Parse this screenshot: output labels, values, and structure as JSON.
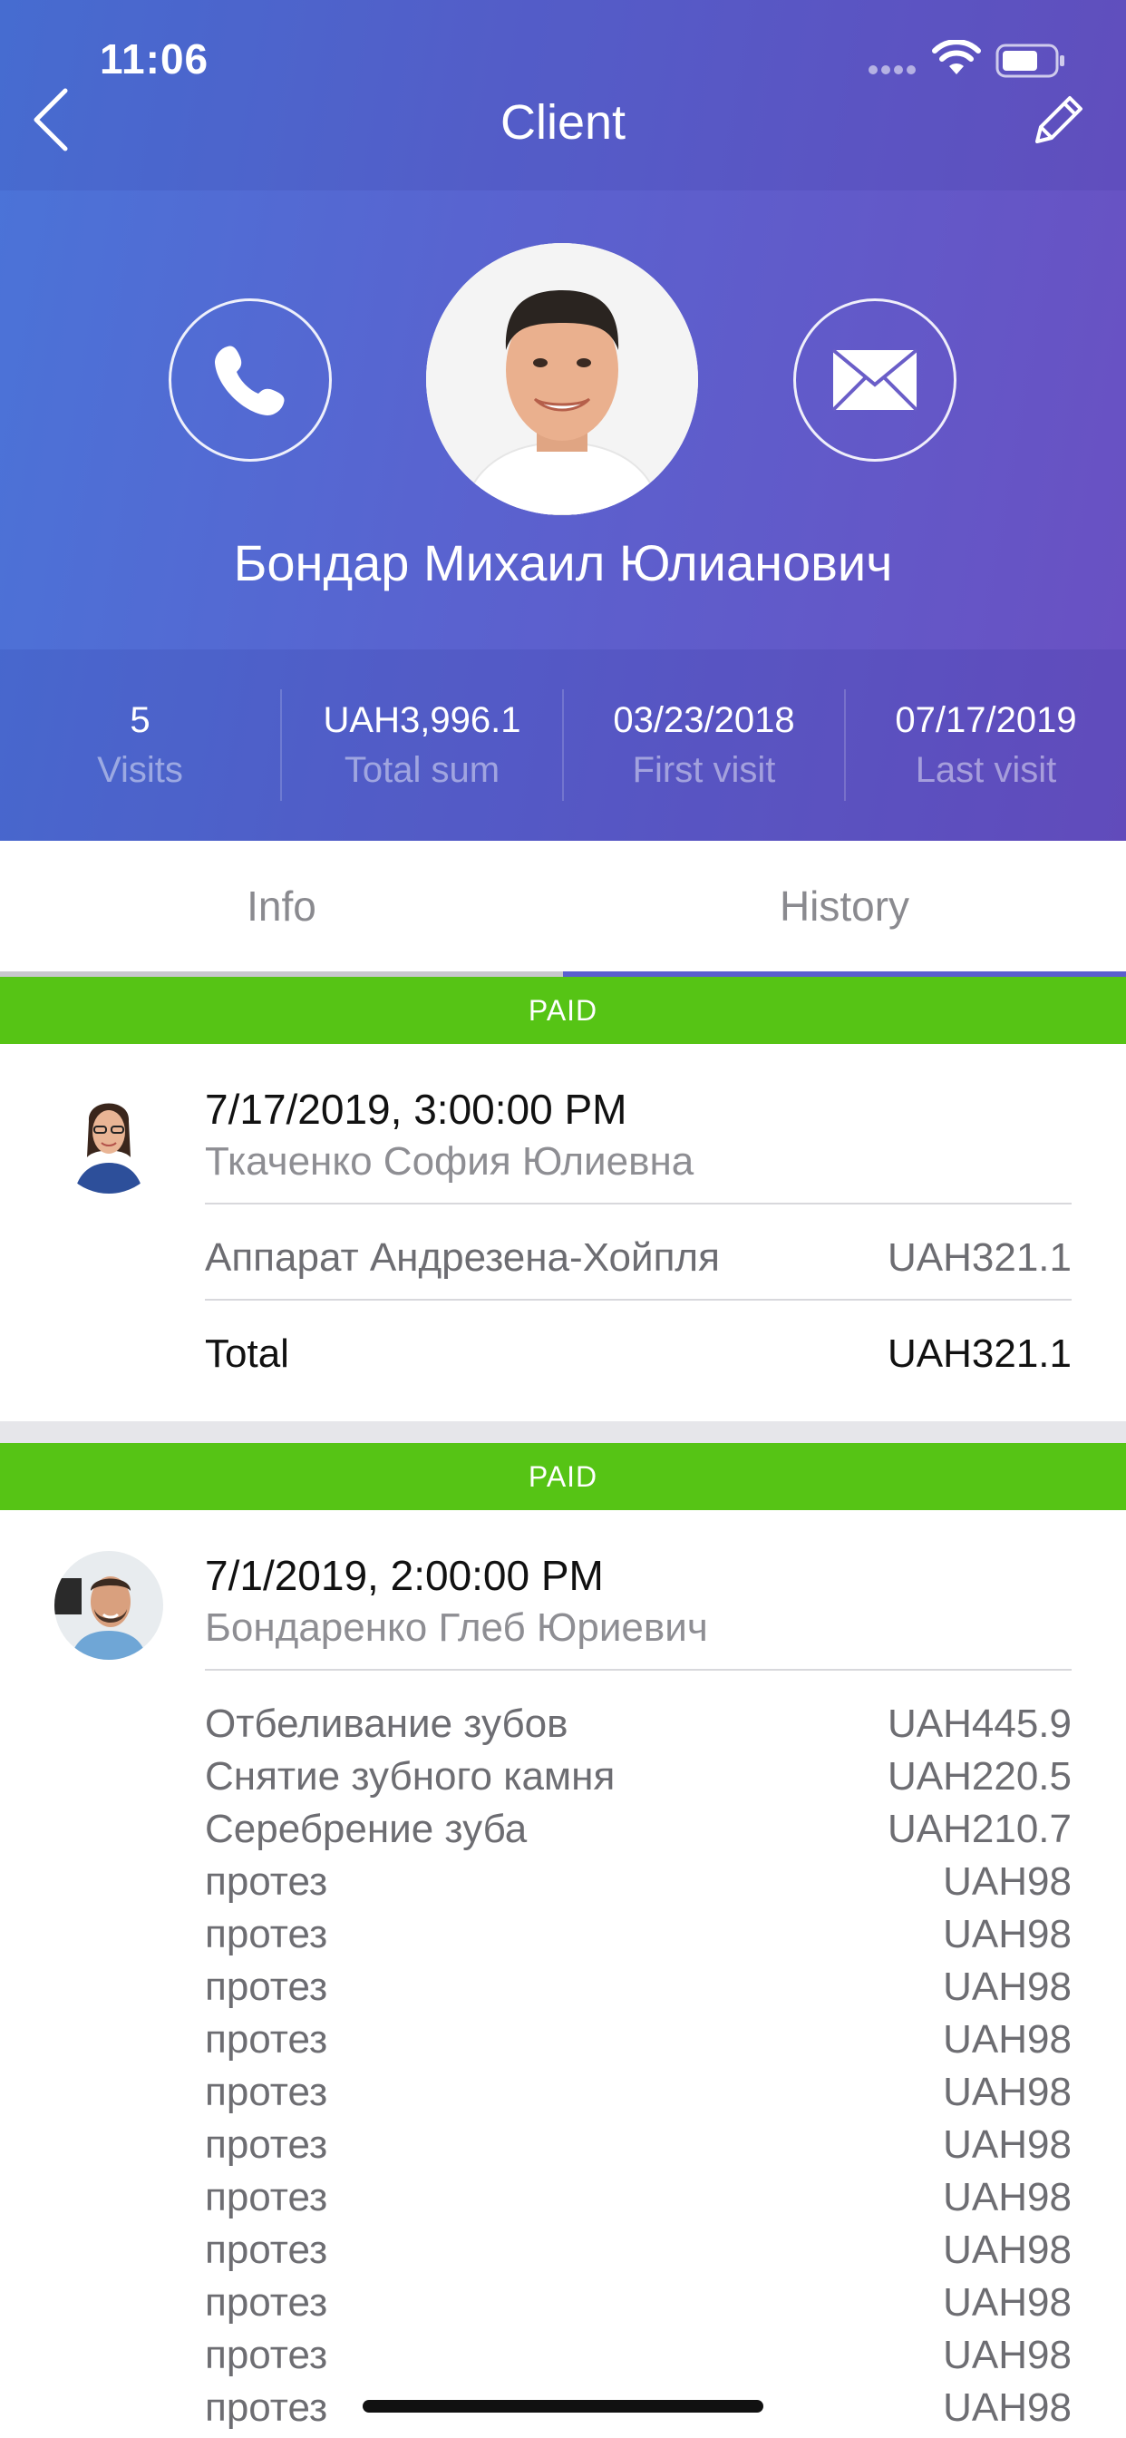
{
  "status": {
    "time": "11:06"
  },
  "nav": {
    "title": "Client"
  },
  "client": {
    "name": "Бондар Михаил Юлианович"
  },
  "stats": [
    {
      "value": "5",
      "label": "Visits"
    },
    {
      "value": "UAH3,996.1",
      "label": "Total sum"
    },
    {
      "value": "03/23/2018",
      "label": "First visit"
    },
    {
      "value": "07/17/2019",
      "label": "Last visit"
    }
  ],
  "tabs": [
    {
      "label": "Info",
      "active": false
    },
    {
      "label": "History",
      "active": true
    }
  ],
  "visits": [
    {
      "status": "PAID",
      "datetime": "7/17/2019, 3:00:00 PM",
      "doctor": "Ткаченко София Юлиевна",
      "items": [
        {
          "name": "Аппарат Андрезена-Хойпля",
          "price": "UAH321.1"
        }
      ],
      "total_label": "Total",
      "total": "UAH321.1"
    },
    {
      "status": "PAID",
      "datetime": "7/1/2019, 2:00:00 PM",
      "doctor": "Бондаренко Глеб Юриевич",
      "items": [
        {
          "name": "Отбеливание зубов",
          "price": "UAH445.9"
        },
        {
          "name": "Снятие зубного камня",
          "price": "UAH220.5"
        },
        {
          "name": "Серебрение зуба",
          "price": "UAH210.7"
        },
        {
          "name": "протез",
          "price": "UAH98"
        },
        {
          "name": "протез",
          "price": "UAH98"
        },
        {
          "name": "протез",
          "price": "UAH98"
        },
        {
          "name": "протез",
          "price": "UAH98"
        },
        {
          "name": "протез",
          "price": "UAH98"
        },
        {
          "name": "протез",
          "price": "UAH98"
        },
        {
          "name": "протез",
          "price": "UAH98"
        },
        {
          "name": "протез",
          "price": "UAH98"
        },
        {
          "name": "протез",
          "price": "UAH98"
        },
        {
          "name": "протез",
          "price": "UAH98"
        },
        {
          "name": "протез",
          "price": "UAH98"
        }
      ]
    }
  ],
  "colors": {
    "paid": "#56c415",
    "gradient_start": "#4a74d8",
    "gradient_end": "#6a50c2",
    "tab_active": "#5a5fcf"
  }
}
